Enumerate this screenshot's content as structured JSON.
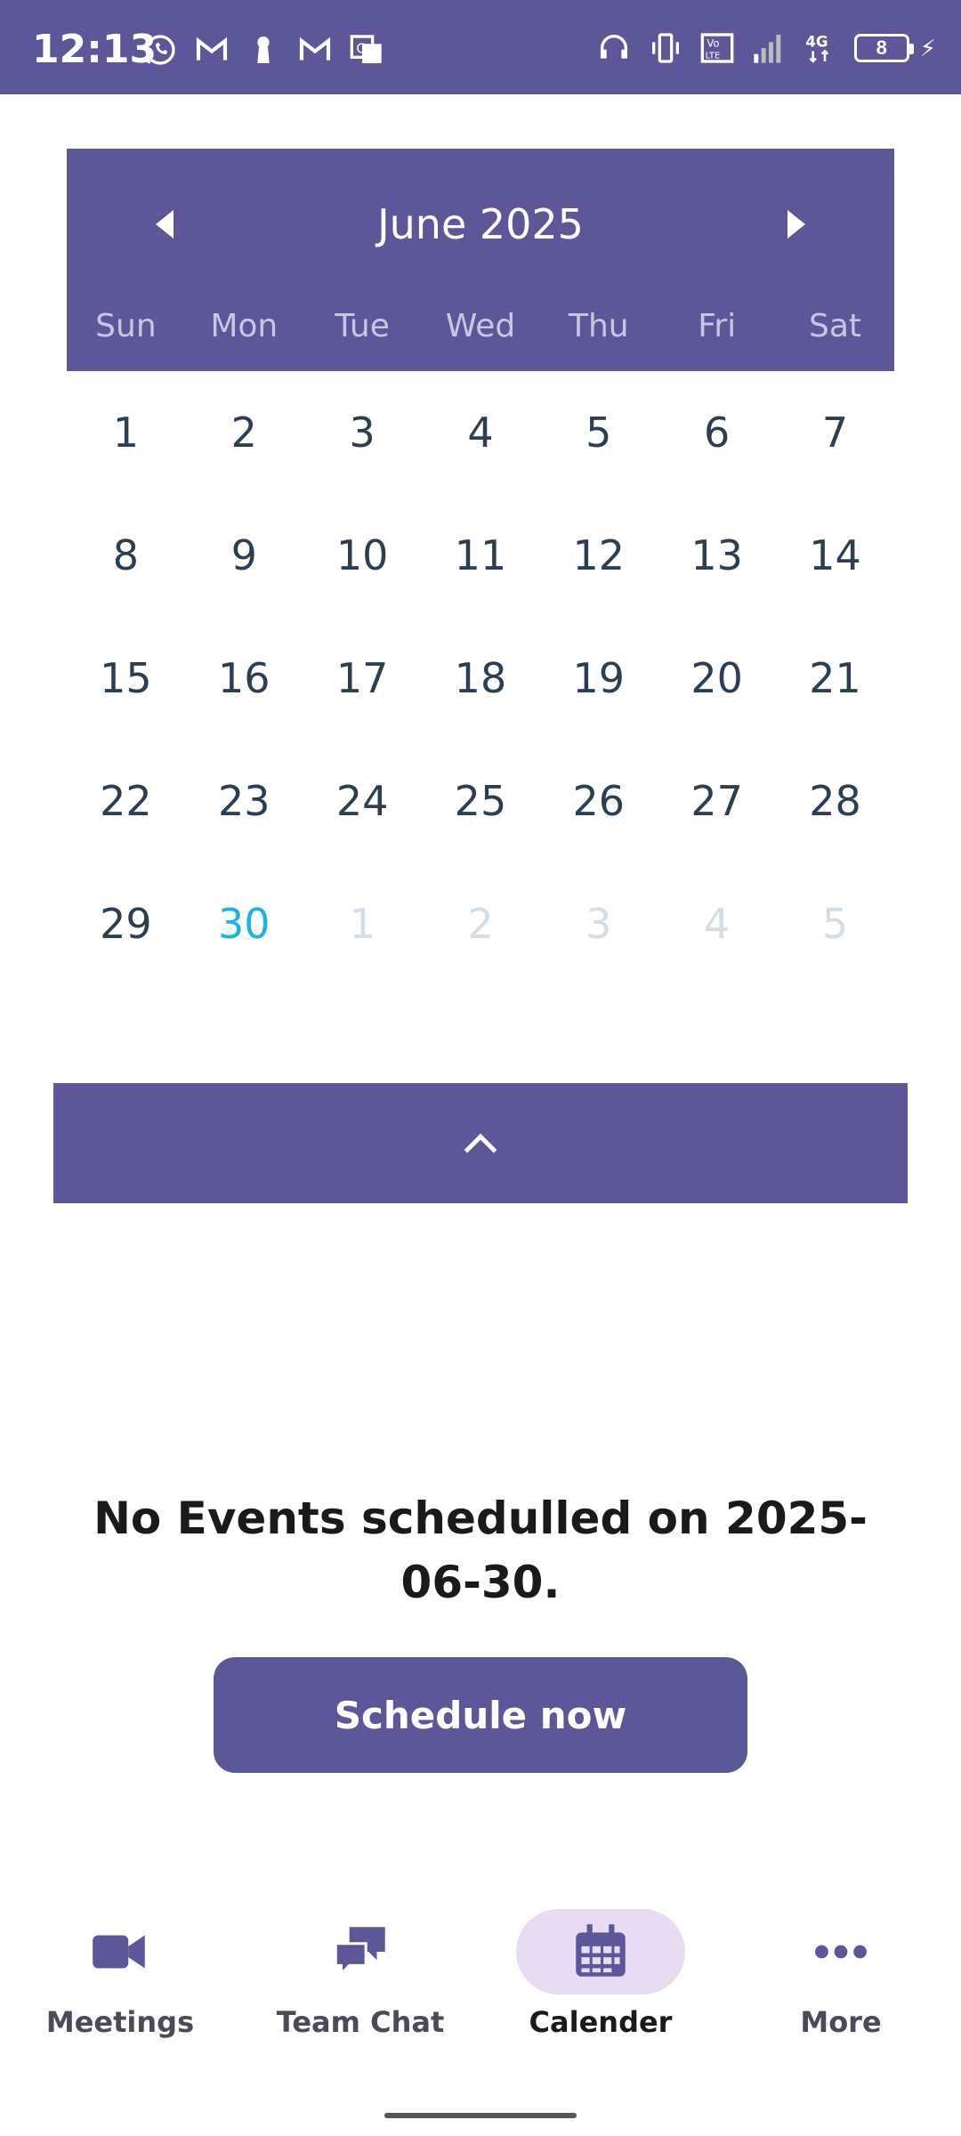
{
  "status_bar": {
    "time": "12:13",
    "battery_level": "8",
    "left_icons": [
      "whatsapp-icon",
      "gmail-icon",
      "keyhole-icon",
      "gmail-icon",
      "translate-icon"
    ],
    "right_icons": [
      "headset-icon",
      "vibrate-icon",
      "volte-icon",
      "signal-icon",
      "4g-icon",
      "battery-icon",
      "charging-icon"
    ]
  },
  "calendar": {
    "month_title": "June 2025",
    "weekdays": [
      "Sun",
      "Mon",
      "Tue",
      "Wed",
      "Thu",
      "Fri",
      "Sat"
    ],
    "weeks": [
      [
        "1",
        "2",
        "3",
        "4",
        "5",
        "6",
        "7"
      ],
      [
        "8",
        "9",
        "10",
        "11",
        "12",
        "13",
        "14"
      ],
      [
        "15",
        "16",
        "17",
        "18",
        "19",
        "20",
        "21"
      ],
      [
        "22",
        "23",
        "24",
        "25",
        "26",
        "27",
        "28"
      ],
      [
        "29",
        "30",
        "1",
        "2",
        "3",
        "4",
        "5"
      ]
    ],
    "selected_day": "30",
    "header_color": "#5b5799",
    "today_color": "#1ab3e6"
  },
  "empty_state": {
    "message": "No Events  schedulled on 2025-06-30.",
    "button_label": "Schedule now"
  },
  "bottom_nav": {
    "items": [
      {
        "label": "Meetings",
        "icon": "video-camera-icon"
      },
      {
        "label": "Team Chat",
        "icon": "chat-bubbles-icon"
      },
      {
        "label": "Calender",
        "icon": "calendar-icon"
      },
      {
        "label": "More",
        "icon": "more-dots-icon"
      }
    ],
    "active": "Calender"
  }
}
